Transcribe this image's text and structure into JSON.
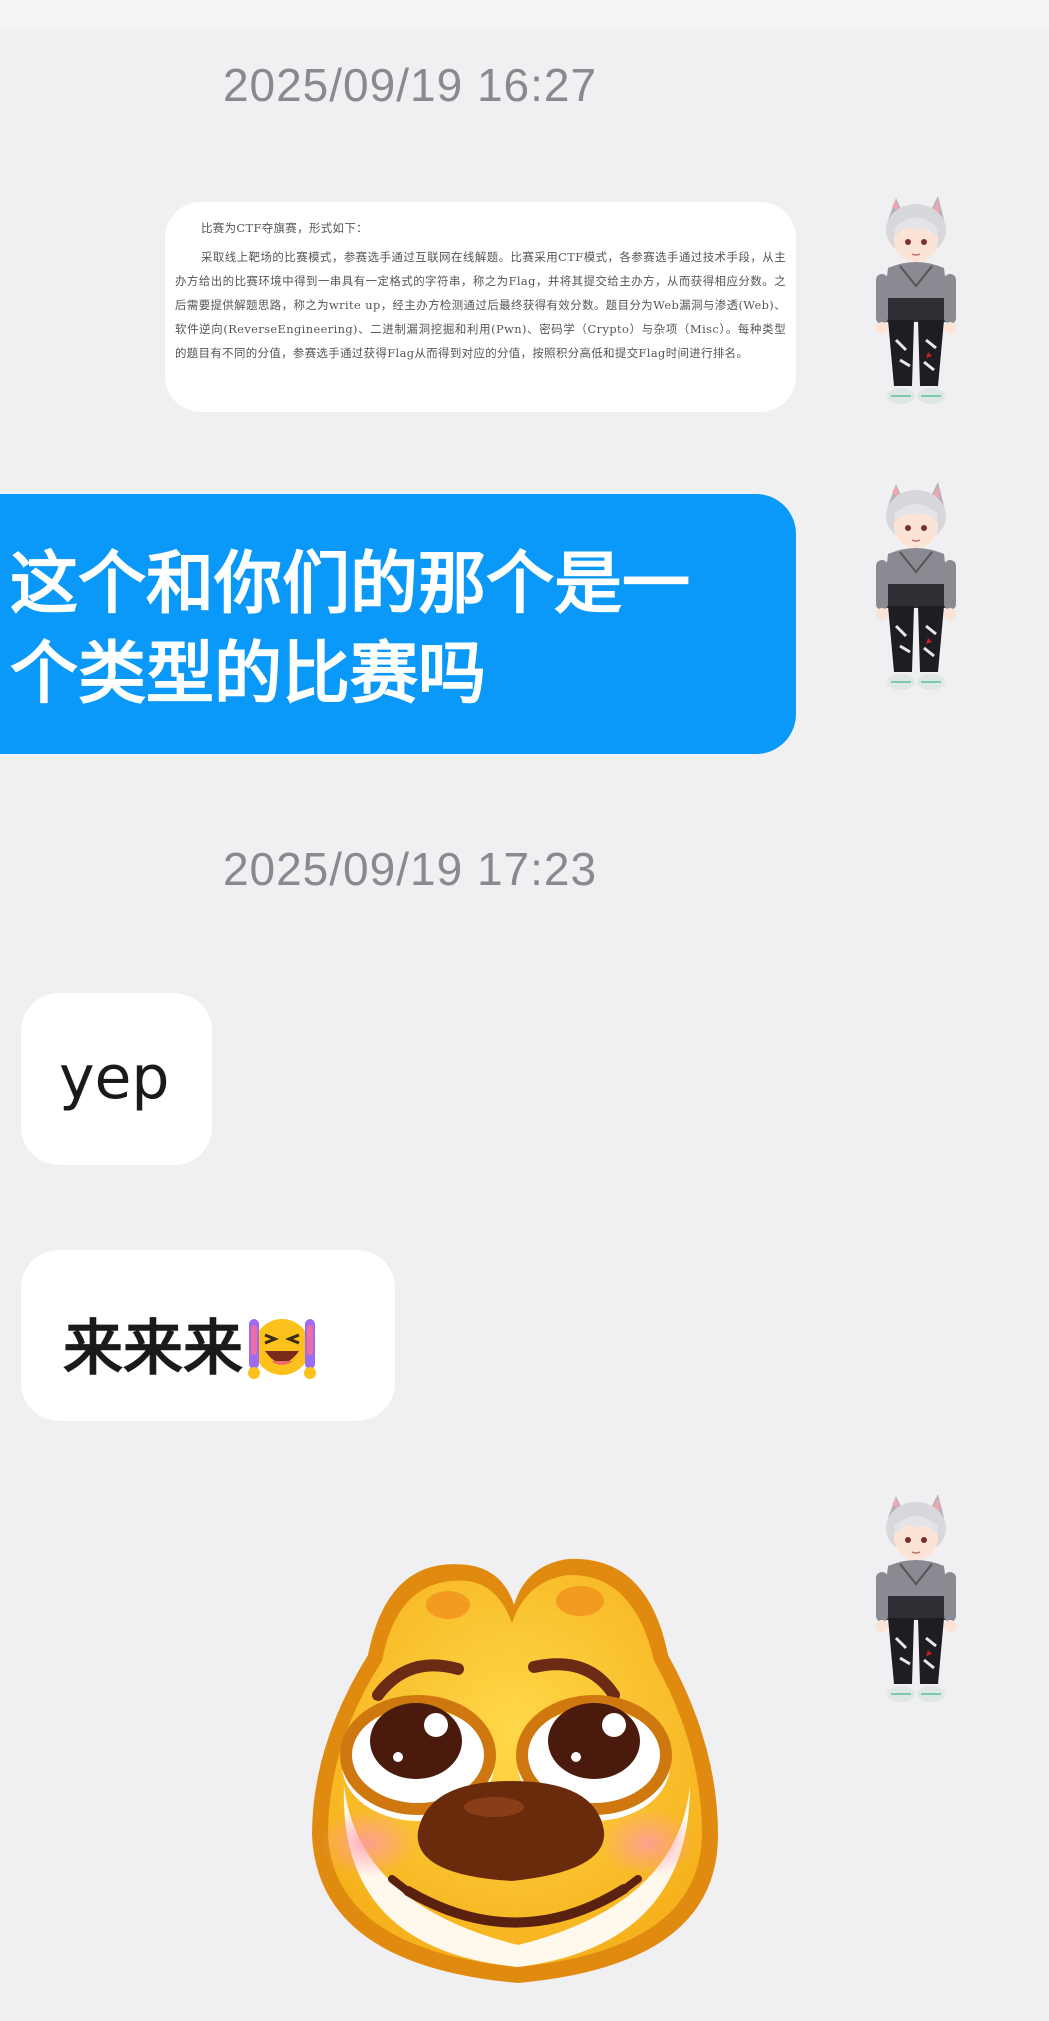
{
  "messages": {
    "timestamp_1": "2025/09/19 16:27",
    "doc_image": {
      "title": "比赛为CTF夺旗赛，形式如下：",
      "body": "采取线上靶场的比赛模式，参赛选手通过互联网在线解题。比赛采用CTF模式，各参赛选手通过技术手段，从主办方给出的比赛环境中得到一串具有一定格式的字符串，称之为Flag，并将其提交给主办方，从而获得相应分数。之后需要提供解题思路，称之为write up，经主办方检测通过后最终获得有效分数。题目分为Web漏洞与渗透(Web)、软件逆向(ReverseEngineering)、二进制漏洞挖掘和利用(Pwn)、密码学（Crypto）与杂项（Misc）。每种类型的题目有不同的分值，参赛选手通过获得Flag从而得到对应的分值，按照积分高低和提交Flag时间进行排名。"
    },
    "question": "这个和你们的那个是一个类型的比赛吗",
    "timestamp_2": "2025/09/19 17:23",
    "reply_1": "yep",
    "reply_2": "来来来",
    "icons": {
      "laugh_emoji": "rolling-laughing-emoji",
      "sticker": "pleading-dog-sticker",
      "avatar": "anime-boy-avatar"
    }
  },
  "colors": {
    "background": "#f0f0f2",
    "outgoing_bubble": "#0a99f8",
    "incoming_bubble": "#ffffff",
    "timestamp_text": "#8a8a8e"
  }
}
